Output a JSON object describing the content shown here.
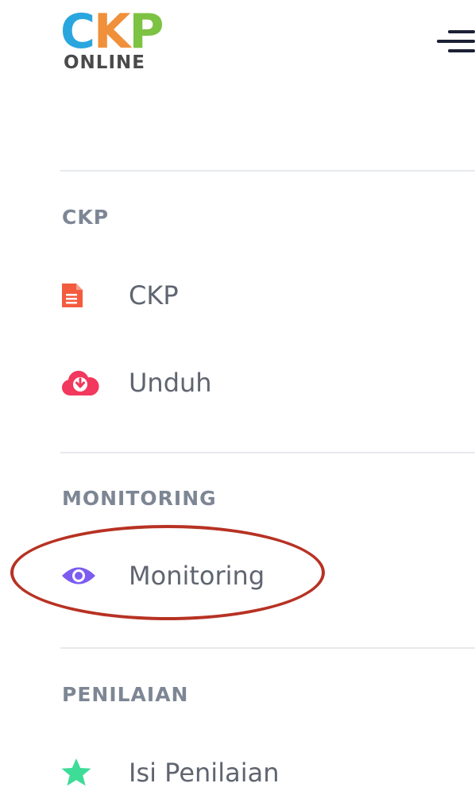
{
  "logo": {
    "letters": [
      "C",
      "K",
      "P"
    ],
    "subtitle": "ONLINE",
    "colors": {
      "c": "#2aa6df",
      "k": "#f0903a",
      "p": "#7cc243",
      "sub": "#4a4a4a"
    }
  },
  "header": {
    "menu_icon": "hamburger-icon"
  },
  "sections": [
    {
      "title": "CKP",
      "items": [
        {
          "label": "CKP",
          "icon": "document-icon",
          "icon_color": "#f35b3f"
        },
        {
          "label": "Unduh",
          "icon": "cloud-download-icon",
          "icon_color": "#f2385e"
        }
      ]
    },
    {
      "title": "MONITORING",
      "items": [
        {
          "label": "Monitoring",
          "icon": "eye-icon",
          "icon_color": "#7c5cf0"
        }
      ]
    },
    {
      "title": "PENILAIAN",
      "items": [
        {
          "label": "Isi Penilaian",
          "icon": "star-icon",
          "icon_color": "#3ddc97"
        }
      ]
    }
  ],
  "colors": {
    "divider": "#e7e9ee",
    "section_title": "#7d8694",
    "menu_text": "#5f6570",
    "annotation": "#b73223"
  }
}
